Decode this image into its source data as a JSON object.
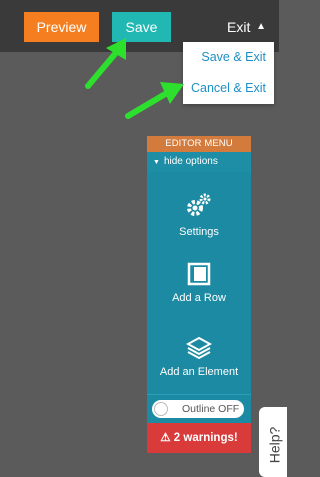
{
  "topbar": {
    "preview_label": "Preview",
    "save_label": "Save",
    "exit_label": "Exit",
    "exit_caret": "^"
  },
  "exit_menu": {
    "items": [
      {
        "label": "Save & Exit"
      },
      {
        "label": "Cancel & Exit"
      }
    ]
  },
  "editor_menu": {
    "title": "EDITOR MENU",
    "hide_options": "hide options",
    "tools": [
      {
        "label": "Settings",
        "icon": "gear-icon"
      },
      {
        "label": "Add a Row",
        "icon": "row-layout-icon"
      },
      {
        "label": "Add an Element",
        "icon": "layers-icon"
      }
    ],
    "outline_label": "Outline OFF",
    "warnings_label": "2 warnings!"
  },
  "help": {
    "label": "Help?"
  },
  "colors": {
    "preview": "#f57f20",
    "save": "#21b7b3",
    "editor_body": "#1b8aa2",
    "warning": "#d93b3b",
    "arrow": "#2ee02e"
  }
}
